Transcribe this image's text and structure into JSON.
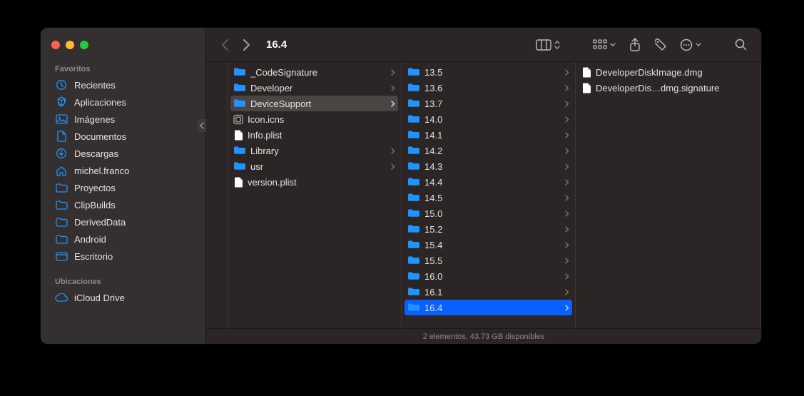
{
  "window": {
    "title": "16.4"
  },
  "sidebar": {
    "sections": {
      "favoritos": "Favoritos",
      "ubicaciones": "Ubicaciones"
    },
    "favoritos_items": [
      {
        "label": "Recientes",
        "icon": "clock-icon"
      },
      {
        "label": "Aplicaciones",
        "icon": "apps-icon"
      },
      {
        "label": "Imágenes",
        "icon": "images-icon"
      },
      {
        "label": "Documentos",
        "icon": "documents-icon"
      },
      {
        "label": "Descargas",
        "icon": "downloads-icon"
      },
      {
        "label": "michel.franco",
        "icon": "home-icon"
      },
      {
        "label": "Proyectos",
        "icon": "folder-icon"
      },
      {
        "label": "ClipBuilds",
        "icon": "folder-icon"
      },
      {
        "label": "DerivedData",
        "icon": "folder-icon"
      },
      {
        "label": "Android",
        "icon": "folder-icon"
      },
      {
        "label": "Escritorio",
        "icon": "desktop-icon"
      }
    ],
    "ubicaciones_items": [
      {
        "label": "iCloud Drive",
        "icon": "cloud-icon"
      }
    ]
  },
  "columns": {
    "col2": [
      {
        "label": "_CodeSignature",
        "type": "folder"
      },
      {
        "label": "Developer",
        "type": "folder"
      },
      {
        "label": "DeviceSupport",
        "type": "folder",
        "selected": true
      },
      {
        "label": "Icon.icns",
        "type": "file-icon"
      },
      {
        "label": "Info.plist",
        "type": "file"
      },
      {
        "label": "Library",
        "type": "folder"
      },
      {
        "label": "usr",
        "type": "folder"
      },
      {
        "label": "version.plist",
        "type": "file"
      }
    ],
    "col3": [
      {
        "label": "13.5",
        "type": "folder"
      },
      {
        "label": "13.6",
        "type": "folder"
      },
      {
        "label": "13.7",
        "type": "folder"
      },
      {
        "label": "14.0",
        "type": "folder"
      },
      {
        "label": "14.1",
        "type": "folder"
      },
      {
        "label": "14.2",
        "type": "folder"
      },
      {
        "label": "14.3",
        "type": "folder"
      },
      {
        "label": "14.4",
        "type": "folder"
      },
      {
        "label": "14.5",
        "type": "folder"
      },
      {
        "label": "15.0",
        "type": "folder"
      },
      {
        "label": "15.2",
        "type": "folder"
      },
      {
        "label": "15.4",
        "type": "folder"
      },
      {
        "label": "15.5",
        "type": "folder"
      },
      {
        "label": "16.0",
        "type": "folder"
      },
      {
        "label": "16.1",
        "type": "folder"
      },
      {
        "label": "16.4",
        "type": "folder",
        "selected_blue": true
      }
    ],
    "col4": [
      {
        "label": "DeveloperDiskImage.dmg",
        "type": "file"
      },
      {
        "label": "DeveloperDis…dmg.signature",
        "type": "file"
      }
    ]
  },
  "statusbar": "2 elementos, 43.73 GB disponibles"
}
